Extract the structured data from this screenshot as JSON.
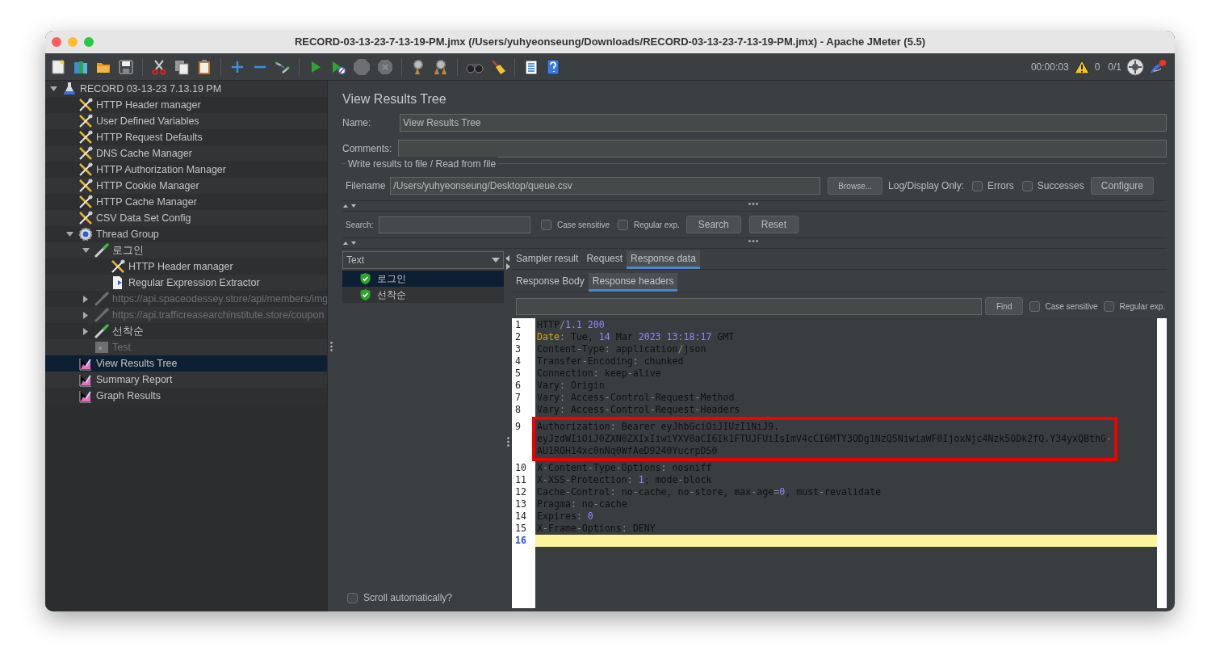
{
  "window": {
    "title": "RECORD-03-13-23-7-13-19-PM.jmx (/Users/yuhyeonseung/Downloads/RECORD-03-13-23-7-13-19-PM.jmx) - Apache JMeter (5.5)"
  },
  "toolbar": {
    "elapsed": "00:00:03",
    "warnings": "0",
    "threads": "0/1"
  },
  "tree": [
    {
      "label": "RECORD 03-13-23 7.13.19 PM",
      "kind": "testplan",
      "expanded": true,
      "disabled": false,
      "selected": false,
      "children": [
        {
          "label": "HTTP Header manager",
          "kind": "config",
          "disabled": false,
          "selected": false
        },
        {
          "label": "User Defined Variables",
          "kind": "config",
          "disabled": false,
          "selected": false
        },
        {
          "label": "HTTP Request Defaults",
          "kind": "config",
          "disabled": false,
          "selected": false
        },
        {
          "label": "DNS Cache Manager",
          "kind": "config",
          "disabled": false,
          "selected": false
        },
        {
          "label": "HTTP Authorization Manager",
          "kind": "config",
          "disabled": false,
          "selected": false
        },
        {
          "label": "HTTP Cookie Manager",
          "kind": "config",
          "disabled": false,
          "selected": false
        },
        {
          "label": "HTTP Cache Manager",
          "kind": "config",
          "disabled": false,
          "selected": false
        },
        {
          "label": "CSV Data Set Config",
          "kind": "config",
          "disabled": false,
          "selected": false
        },
        {
          "label": "Thread Group",
          "kind": "threadgroup",
          "expanded": true,
          "disabled": false,
          "selected": false,
          "children": [
            {
              "label": "로그인",
              "kind": "sampler",
              "expanded": true,
              "disabled": false,
              "selected": false,
              "children": [
                {
                  "label": "HTTP Header manager",
                  "kind": "config",
                  "disabled": false,
                  "selected": false
                },
                {
                  "label": "Regular Expression Extractor",
                  "kind": "extractor",
                  "disabled": false,
                  "selected": false
                }
              ]
            },
            {
              "label": "https://api.spaceodessey.store/api/members/img",
              "kind": "sampler",
              "expanded": false,
              "disabled": true,
              "selected": false
            },
            {
              "label": "https://api.trafficreasearchinstitute.store/coupon",
              "kind": "sampler",
              "expanded": false,
              "disabled": true,
              "selected": false
            },
            {
              "label": "선착순",
              "kind": "sampler",
              "expanded": false,
              "disabled": false,
              "selected": false
            },
            {
              "label": "Test",
              "kind": "controller",
              "disabled": true,
              "selected": false
            }
          ]
        },
        {
          "label": "View Results Tree",
          "kind": "listener",
          "disabled": false,
          "selected": true
        },
        {
          "label": "Summary Report",
          "kind": "listener",
          "disabled": false,
          "selected": false
        },
        {
          "label": "Graph Results",
          "kind": "listener",
          "disabled": false,
          "selected": false
        }
      ]
    }
  ],
  "panel": {
    "title": "View Results Tree",
    "name_label": "Name:",
    "name_value": "View Results Tree",
    "comments_label": "Comments:",
    "file_group": {
      "title": "Write results to file / Read from file",
      "filename_label": "Filename",
      "filename_value": "/Users/yuhyeonseung/Desktop/queue.csv",
      "browse_button": "Browse...",
      "log_label": "Log/Display Only:",
      "options": [
        {
          "label": "Errors",
          "checked": false
        },
        {
          "label": "Successes",
          "checked": false
        }
      ],
      "configure_button": "Configure"
    },
    "search": {
      "label": "Search:",
      "options": [
        {
          "label": "Case sensitive",
          "checked": false
        },
        {
          "label": "Regular exp.",
          "checked": false
        }
      ],
      "search_button": "Search",
      "reset_button": "Reset"
    }
  },
  "results": {
    "renderer": "Text",
    "items": [
      {
        "label": "로그인",
        "success": true,
        "selected": true
      },
      {
        "label": "선착순",
        "success": true,
        "selected": false
      }
    ],
    "scroll_option": {
      "label": "Scroll automatically?",
      "checked": false
    }
  },
  "tabs": [
    {
      "label": "Sampler result",
      "selected": false
    },
    {
      "label": "Request",
      "selected": false
    },
    {
      "label": "Response data",
      "selected": true
    }
  ],
  "subtabs": [
    {
      "label": "Response Body",
      "selected": false
    },
    {
      "label": "Response headers",
      "selected": true
    }
  ],
  "find": {
    "button": "Find",
    "options": [
      {
        "label": "Case sensitive",
        "checked": false
      },
      {
        "label": "Regular exp.",
        "checked": false
      }
    ]
  },
  "response": {
    "lines": [
      {
        "number": "1",
        "current": false,
        "segments": [
          {
            "text": "HTTP",
            "kind": "plain"
          },
          {
            "text": "/",
            "kind": "punct"
          },
          {
            "text": "1.1 200",
            "kind": "number"
          }
        ]
      },
      {
        "number": "2",
        "current": false,
        "segments": [
          {
            "text": "Date",
            "kind": "key"
          },
          {
            "text": ":",
            "kind": "punct"
          },
          {
            "text": " Tue, ",
            "kind": "plain"
          },
          {
            "text": "14",
            "kind": "number"
          },
          {
            "text": " Mar ",
            "kind": "plain"
          },
          {
            "text": "2023 13:18:17",
            "kind": "number"
          },
          {
            "text": " GMT",
            "kind": "plain"
          }
        ]
      },
      {
        "number": "3",
        "current": false,
        "segments": [
          {
            "text": "Content",
            "kind": "plain"
          },
          {
            "text": "-",
            "kind": "punct"
          },
          {
            "text": "Type",
            "kind": "plain"
          },
          {
            "text": ":",
            "kind": "punct"
          },
          {
            "text": " application",
            "kind": "plain"
          },
          {
            "text": "/",
            "kind": "punct"
          },
          {
            "text": "json",
            "kind": "plain"
          }
        ]
      },
      {
        "number": "4",
        "current": false,
        "segments": [
          {
            "text": "Transfer",
            "kind": "plain"
          },
          {
            "text": "-",
            "kind": "punct"
          },
          {
            "text": "Encoding",
            "kind": "plain"
          },
          {
            "text": ":",
            "kind": "punct"
          },
          {
            "text": " chunked",
            "kind": "plain"
          }
        ]
      },
      {
        "number": "5",
        "current": false,
        "segments": [
          {
            "text": "Connection",
            "kind": "plain"
          },
          {
            "text": ":",
            "kind": "punct"
          },
          {
            "text": " keep",
            "kind": "plain"
          },
          {
            "text": "-",
            "kind": "punct"
          },
          {
            "text": "alive",
            "kind": "plain"
          }
        ]
      },
      {
        "number": "6",
        "current": false,
        "segments": [
          {
            "text": "Vary",
            "kind": "plain"
          },
          {
            "text": ":",
            "kind": "punct"
          },
          {
            "text": " Origin",
            "kind": "plain"
          }
        ]
      },
      {
        "number": "7",
        "current": false,
        "segments": [
          {
            "text": "Vary",
            "kind": "plain"
          },
          {
            "text": ":",
            "kind": "punct"
          },
          {
            "text": " Access",
            "kind": "plain"
          },
          {
            "text": "-",
            "kind": "punct"
          },
          {
            "text": "Control",
            "kind": "plain"
          },
          {
            "text": "-",
            "kind": "punct"
          },
          {
            "text": "Request",
            "kind": "plain"
          },
          {
            "text": "-",
            "kind": "punct"
          },
          {
            "text": "Method",
            "kind": "plain"
          }
        ]
      },
      {
        "number": "8",
        "current": false,
        "segments": [
          {
            "text": "Vary",
            "kind": "plain"
          },
          {
            "text": ":",
            "kind": "punct"
          },
          {
            "text": " Access",
            "kind": "plain"
          },
          {
            "text": "-",
            "kind": "punct"
          },
          {
            "text": "Control",
            "kind": "plain"
          },
          {
            "text": "-",
            "kind": "punct"
          },
          {
            "text": "Request",
            "kind": "plain"
          },
          {
            "text": "-",
            "kind": "punct"
          },
          {
            "text": "Headers",
            "kind": "plain"
          }
        ]
      },
      {
        "number": "9",
        "current": false,
        "marked": true,
        "segments": [
          {
            "text": "Authorization",
            "kind": "plain"
          },
          {
            "text": ":",
            "kind": "punct"
          },
          {
            "text": " Bearer eyJhbGciOiJIUzI1NiJ9.",
            "kind": "plain"
          }
        ]
      },
      {
        "continuation": true,
        "segments": [
          {
            "text": "eyJzdWIiOiJ0ZXN0ZXIxIiwiYXV0aCI6Ik1FTUJFUiIsImV4cCI6MTY3ODg1NzQ5NiwiaWF0IjoxNjc4Nzk5ODk2fQ.Y34yxQBthG",
            "kind": "plain"
          },
          {
            "text": "-",
            "kind": "punct"
          }
        ]
      },
      {
        "continuation": true,
        "segments": [
          {
            "text": "AU1ROH14xc0nNq0WfAeD9240YucrpDS0",
            "kind": "plain"
          }
        ]
      },
      {
        "number": "10",
        "current": false,
        "segments": [
          {
            "text": "X",
            "kind": "plain"
          },
          {
            "text": "-",
            "kind": "punct"
          },
          {
            "text": "Content",
            "kind": "plain"
          },
          {
            "text": "-",
            "kind": "punct"
          },
          {
            "text": "Type",
            "kind": "plain"
          },
          {
            "text": "-",
            "kind": "punct"
          },
          {
            "text": "Options",
            "kind": "plain"
          },
          {
            "text": ":",
            "kind": "punct"
          },
          {
            "text": " nosniff",
            "kind": "plain"
          }
        ]
      },
      {
        "number": "11",
        "current": false,
        "segments": [
          {
            "text": "X",
            "kind": "plain"
          },
          {
            "text": "-",
            "kind": "punct"
          },
          {
            "text": "XSS",
            "kind": "plain"
          },
          {
            "text": "-",
            "kind": "punct"
          },
          {
            "text": "Protection",
            "kind": "plain"
          },
          {
            "text": ": ",
            "kind": "punct"
          },
          {
            "text": "1",
            "kind": "number"
          },
          {
            "text": "; mode",
            "kind": "plain"
          },
          {
            "text": "-",
            "kind": "punct"
          },
          {
            "text": "block",
            "kind": "plain"
          }
        ]
      },
      {
        "number": "12",
        "current": false,
        "segments": [
          {
            "text": "Cache",
            "kind": "plain"
          },
          {
            "text": "-",
            "kind": "punct"
          },
          {
            "text": "Control",
            "kind": "plain"
          },
          {
            "text": ":",
            "kind": "punct"
          },
          {
            "text": " no",
            "kind": "plain"
          },
          {
            "text": "-",
            "kind": "punct"
          },
          {
            "text": "cache, no",
            "kind": "plain"
          },
          {
            "text": "-",
            "kind": "punct"
          },
          {
            "text": "store, max",
            "kind": "plain"
          },
          {
            "text": "-",
            "kind": "punct"
          },
          {
            "text": "age",
            "kind": "plain"
          },
          {
            "text": "=",
            "kind": "punct"
          },
          {
            "text": "0",
            "kind": "number"
          },
          {
            "text": ", must",
            "kind": "plain"
          },
          {
            "text": "-",
            "kind": "punct"
          },
          {
            "text": "revalidate",
            "kind": "plain"
          }
        ]
      },
      {
        "number": "13",
        "current": false,
        "segments": [
          {
            "text": "Pragma",
            "kind": "plain"
          },
          {
            "text": ":",
            "kind": "punct"
          },
          {
            "text": " no",
            "kind": "plain"
          },
          {
            "text": "-",
            "kind": "punct"
          },
          {
            "text": "cache",
            "kind": "plain"
          }
        ]
      },
      {
        "number": "14",
        "current": false,
        "segments": [
          {
            "text": "Expires",
            "kind": "plain"
          },
          {
            "text": ": ",
            "kind": "punct"
          },
          {
            "text": "0",
            "kind": "number"
          }
        ]
      },
      {
        "number": "15",
        "current": false,
        "segments": [
          {
            "text": "X",
            "kind": "plain"
          },
          {
            "text": "-",
            "kind": "punct"
          },
          {
            "text": "Frame",
            "kind": "plain"
          },
          {
            "text": "-",
            "kind": "punct"
          },
          {
            "text": "Options",
            "kind": "plain"
          },
          {
            "text": ":",
            "kind": "punct"
          },
          {
            "text": " DENY",
            "kind": "plain"
          }
        ]
      },
      {
        "number": "16",
        "current": true
      }
    ]
  }
}
